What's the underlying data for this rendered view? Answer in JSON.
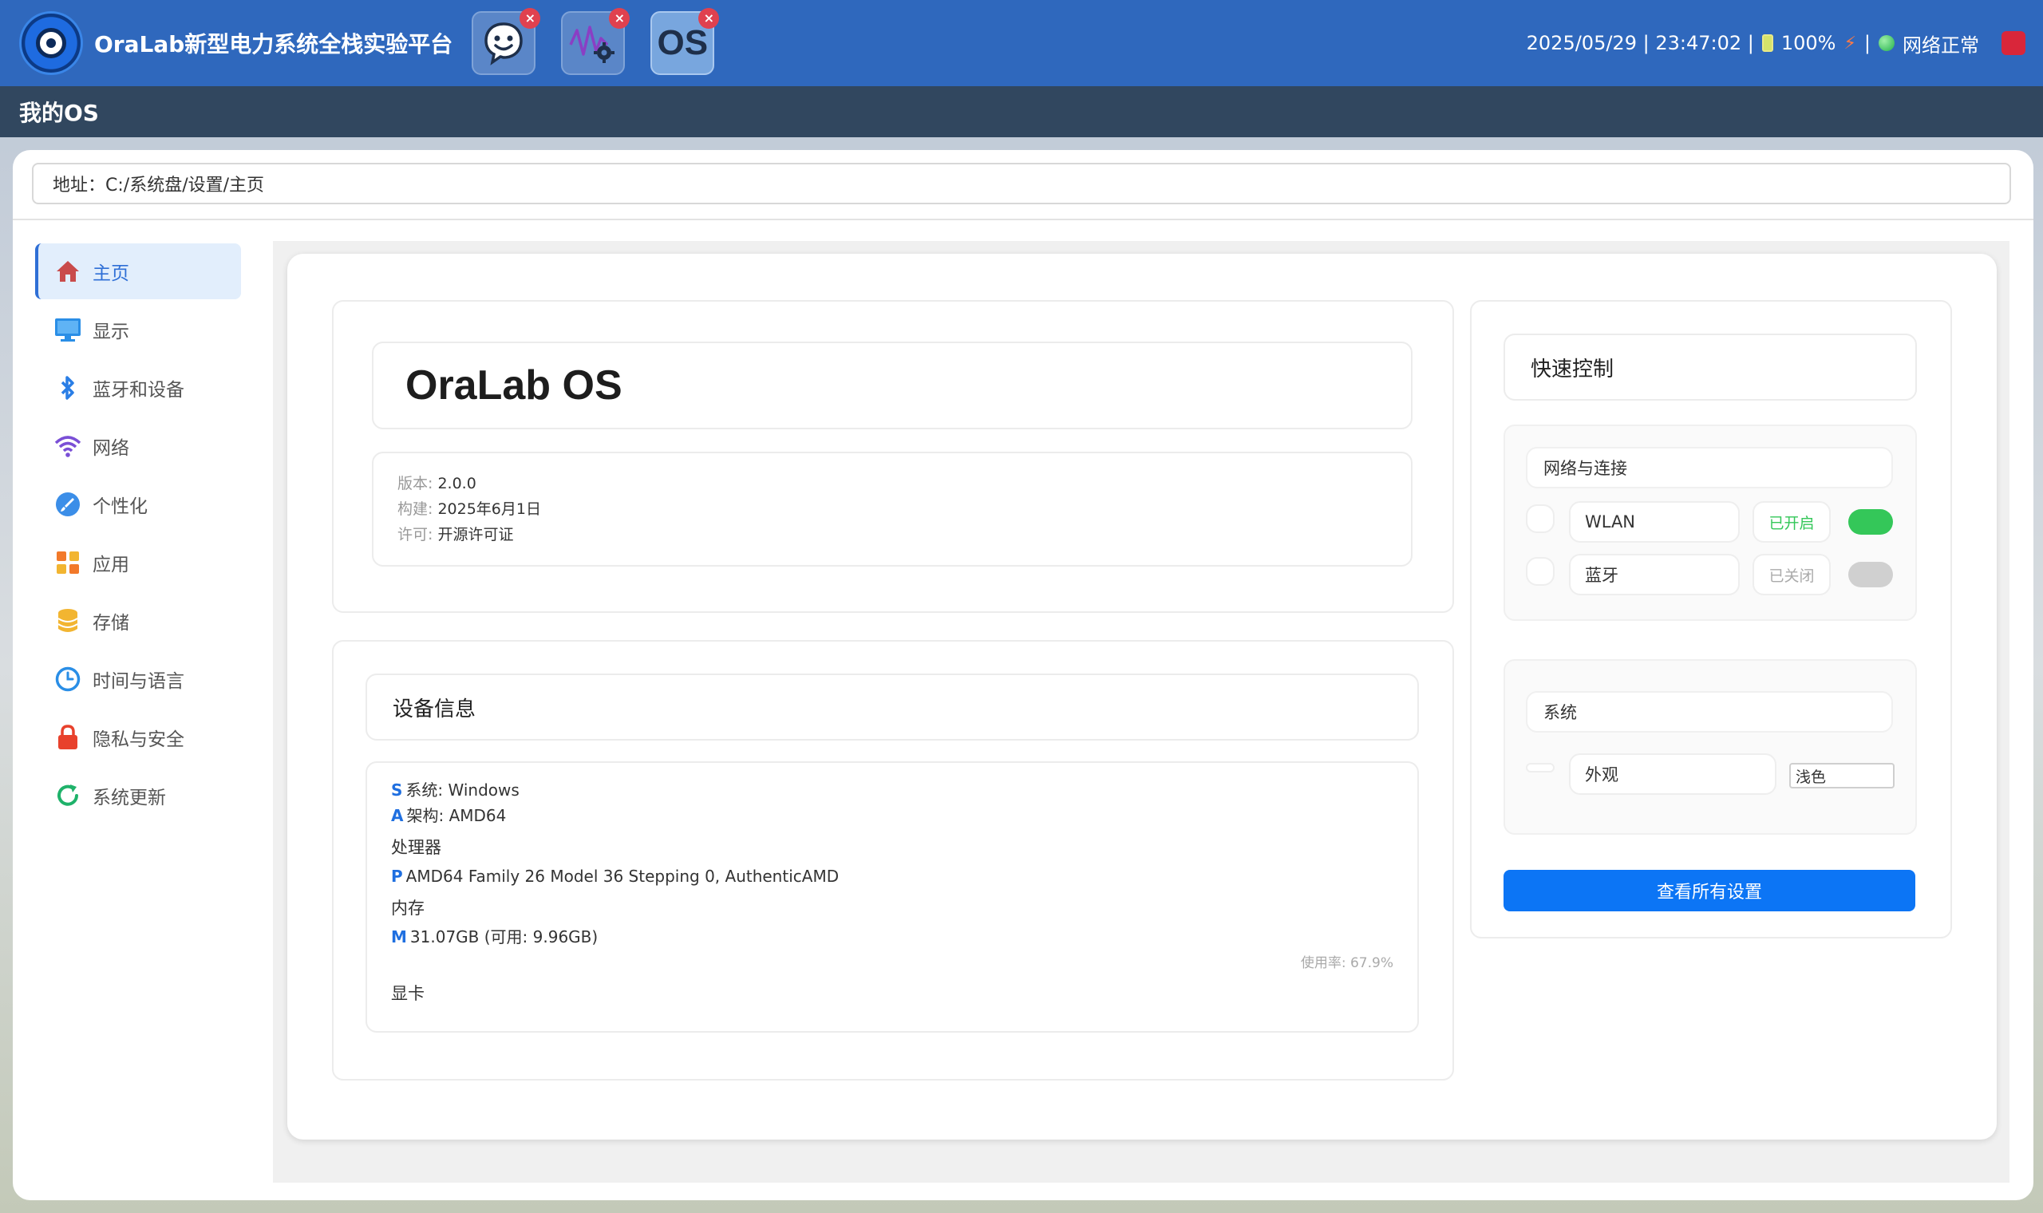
{
  "app": {
    "title": "OraLab新型电力系统全栈实验平台",
    "subtitle": "我的OS"
  },
  "tasks": [
    {
      "name": "chat",
      "label": ""
    },
    {
      "name": "settings-wave",
      "label": ""
    },
    {
      "name": "os",
      "label": "OS"
    }
  ],
  "status": {
    "datetime": "2025/05/29 | 23:47:02 |",
    "battery": "100%",
    "sep": "|",
    "network": "网络正常"
  },
  "address": {
    "label": "地址：",
    "path": "C:/系统盘/设置/主页"
  },
  "sidebar": {
    "items": [
      {
        "label": "主页",
        "icon": "home-icon",
        "color": "#c94b4b"
      },
      {
        "label": "显示",
        "icon": "monitor-icon",
        "color": "#2a8ee6"
      },
      {
        "label": "蓝牙和设备",
        "icon": "bluetooth-icon",
        "color": "#2a7ee6"
      },
      {
        "label": "网络",
        "icon": "wifi-icon",
        "color": "#7a4fd6"
      },
      {
        "label": "个性化",
        "icon": "brush-icon",
        "color": "#3b8ee8"
      },
      {
        "label": "应用",
        "icon": "apps-icon",
        "color": "#f2792a"
      },
      {
        "label": "存储",
        "icon": "database-icon",
        "color": "#f2b531"
      },
      {
        "label": "时间与语言",
        "icon": "clock-icon",
        "color": "#2a8ee6"
      },
      {
        "label": "隐私与安全",
        "icon": "lock-icon",
        "color": "#e8412c"
      },
      {
        "label": "系统更新",
        "icon": "refresh-icon",
        "color": "#1fb26a"
      }
    ]
  },
  "os": {
    "name": "OraLab OS",
    "version_label": "版本:",
    "version": "2.0.0",
    "build_label": "构建:",
    "build": "2025年6月1日",
    "license_label": "许可:",
    "license": "开源许可证"
  },
  "device": {
    "title": "设备信息",
    "os_icon": "S",
    "os_label": "系统:",
    "os_value": "Windows",
    "arch_icon": "A",
    "arch_label": "架构:",
    "arch_value": "AMD64",
    "cpu_title": "处理器",
    "cpu_icon": "P",
    "cpu_value": "AMD64 Family 26 Model 36 Stepping 0, AuthenticAMD",
    "mem_title": "内存",
    "mem_icon": "M",
    "mem_value": "31.07GB (可用: 9.96GB)",
    "mem_usage": "使用率: 67.9%",
    "gpu_title": "显卡"
  },
  "quick": {
    "title": "快速控制",
    "network_section": "网络与连接",
    "wlan_label": "WLAN",
    "wlan_state": "已开启",
    "wlan_on": true,
    "bt_label": "蓝牙",
    "bt_state": "已关闭",
    "bt_on": false,
    "system_section": "系统",
    "appearance_label": "外观",
    "appearance_value": "浅色",
    "all_settings": "查看所有设置"
  },
  "colors": {
    "accent": "#0c75f5",
    "toggle_on": "#34c759",
    "toggle_off": "#d0d0d0",
    "topbar": "#2f68bd"
  }
}
